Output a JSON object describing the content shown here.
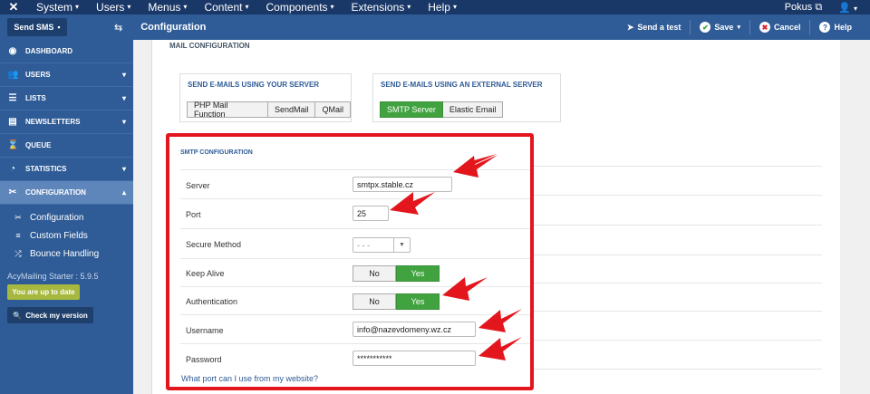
{
  "topbar": {
    "menus": [
      "System",
      "Users",
      "Menus",
      "Content",
      "Components",
      "Extensions",
      "Help"
    ],
    "site_label": "Pokus",
    "logo_icon": "joomla-icon",
    "user_icon": "user-icon"
  },
  "subbar": {
    "send_sms": "Send SMS",
    "page_title": "Configuration",
    "send_test": "Send a test",
    "save": "Save",
    "cancel": "Cancel",
    "help": "Help"
  },
  "sidebar": {
    "items": [
      {
        "label": "DASHBOARD",
        "icon": "dashboard-icon"
      },
      {
        "label": "USERS",
        "icon": "users-icon"
      },
      {
        "label": "LISTS",
        "icon": "list-icon"
      },
      {
        "label": "NEWSLETTERS",
        "icon": "newsletter-icon"
      },
      {
        "label": "QUEUE",
        "icon": "hourglass-icon"
      },
      {
        "label": "STATISTICS",
        "icon": "pie-chart-icon"
      },
      {
        "label": "CONFIGURATION",
        "icon": "tools-icon"
      }
    ],
    "sub_items": [
      "Configuration",
      "Custom Fields",
      "Bounce Handling"
    ],
    "version_text": "AcyMailing Starter : 5.9.5",
    "up_to_date": "You are up to date",
    "check_version": "Check my version"
  },
  "main": {
    "mail_config_title": "MAIL CONFIGURATION",
    "own_server": {
      "title": "SEND E-MAILS USING YOUR SERVER",
      "buttons": [
        "PHP Mail Function",
        "SendMail",
        "QMail"
      ]
    },
    "external_server": {
      "title": "SEND E-MAILS USING AN EXTERNAL SERVER",
      "buttons": [
        "SMTP Server",
        "Elastic Email"
      ],
      "selected": "SMTP Server"
    },
    "smtp": {
      "title": "SMTP CONFIGURATION",
      "server_label": "Server",
      "server_value": "smtpx.stable.cz",
      "port_label": "Port",
      "port_value": "25",
      "secure_label": "Secure Method",
      "secure_value": "- - -",
      "keepalive_label": "Keep Alive",
      "auth_label": "Authentication",
      "no": "No",
      "yes": "Yes",
      "keepalive_value": "Yes",
      "auth_value": "Yes",
      "username_label": "Username",
      "username_value": "info@nazevdomeny.wz.cz",
      "password_label": "Password",
      "password_value": "***********",
      "help_link": "What port can I use from my website?"
    }
  },
  "colors": {
    "header_dark": "#1a3867",
    "header": "#2f5c97",
    "active_green": "#41a33f",
    "highlight_red": "#e3161d"
  }
}
